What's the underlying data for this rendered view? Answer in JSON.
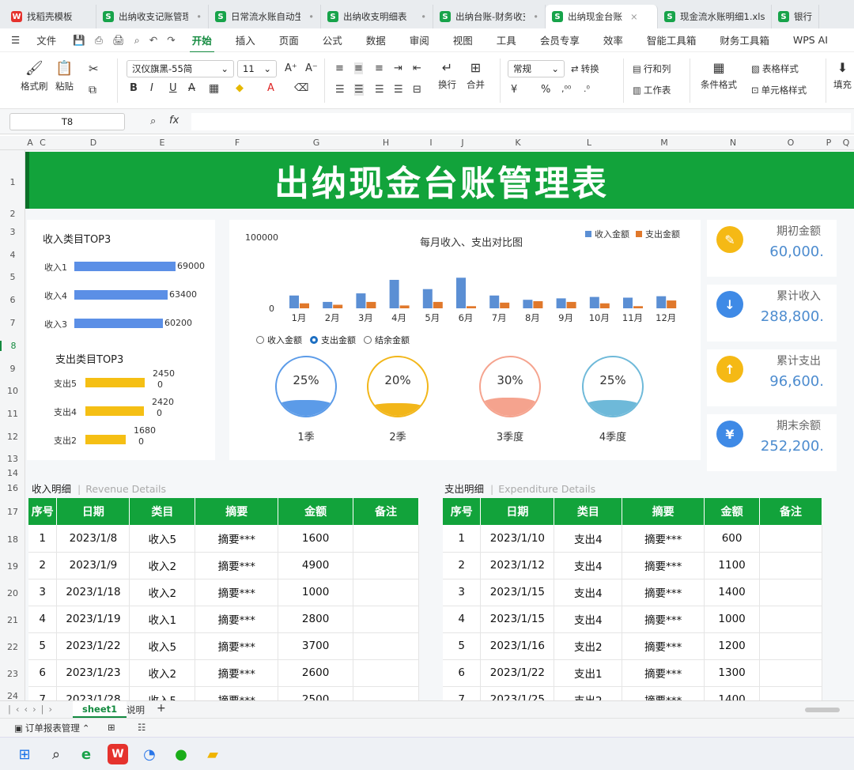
{
  "tabs": [
    {
      "label": "找稻壳模板",
      "icon": "wps-icon"
    },
    {
      "label": "出纳收支记账管理",
      "icon": "sheet-icon"
    },
    {
      "label": "日常流水账自动生",
      "icon": "sheet-icon"
    },
    {
      "label": "出纳收支明细表（",
      "icon": "sheet-icon"
    },
    {
      "label": "出纳台账-财务收支",
      "icon": "sheet-icon"
    },
    {
      "label": "出纳现金台账",
      "icon": "sheet-icon"
    },
    {
      "label": "现金流水账明细1.xlsx",
      "icon": "sheet-icon"
    },
    {
      "label": "银行存",
      "icon": "sheet-icon"
    }
  ],
  "menu": [
    "文件",
    "开始",
    "插入",
    "页面",
    "公式",
    "数据",
    "审阅",
    "视图",
    "工具",
    "会员专享",
    "效率",
    "智能工具箱",
    "财务工具箱",
    "WPS AI"
  ],
  "toolbar": {
    "format_painter": "格式刷",
    "paste": "粘贴",
    "font_name": "汉仪旗黑-55简",
    "font_size": "11",
    "bold": "B",
    "italic": "I",
    "underline": "U",
    "strike": "A",
    "wrap": "换行",
    "merge": "合并",
    "number_format": "常规",
    "convert": "转换",
    "row_col": "行和列",
    "worksheet": "工作表",
    "table_style": "表格样式",
    "cond_format": "条件格式",
    "cell_style": "单元格样式",
    "fill": "填充",
    "yen": "¥",
    "percent": "%"
  },
  "formula": {
    "cell_ref": "T8",
    "fx": "fx",
    "content": ""
  },
  "columns": [
    "A",
    "C",
    "D",
    "E",
    "F",
    "G",
    "H",
    "I",
    "J",
    "K",
    "L",
    "M",
    "N",
    "O",
    "P",
    "Q"
  ],
  "rows": [
    "1",
    "2",
    "3",
    "4",
    "5",
    "6",
    "7",
    "8",
    "9",
    "10",
    "11",
    "12",
    "13",
    "14",
    "15",
    "16",
    "17",
    "18",
    "19",
    "20",
    "21",
    "22",
    "23",
    "24"
  ],
  "banner_title": "出纳现金台账管理表",
  "income_top": {
    "title": "收入类目TOP3",
    "items": [
      {
        "label": "收入1",
        "value": "69000",
        "v": 69000
      },
      {
        "label": "收入4",
        "value": "63400",
        "v": 63400
      },
      {
        "label": "收入3",
        "value": "60200",
        "v": 60200
      }
    ]
  },
  "expense_top": {
    "title": "支出类目TOP3",
    "items": [
      {
        "label": "支出5",
        "value": "2450",
        "zero": "0",
        "v": 2450
      },
      {
        "label": "支出4",
        "value": "2420",
        "zero": "0",
        "v": 2420
      },
      {
        "label": "支出2",
        "value": "1680",
        "zero": "0",
        "v": 1680
      }
    ]
  },
  "chart_data": {
    "type": "bar",
    "title": "每月收入、支出对比图",
    "categories": [
      "1月",
      "2月",
      "3月",
      "4月",
      "5月",
      "6月",
      "7月",
      "8月",
      "9月",
      "10月",
      "11月",
      "12月"
    ],
    "series": [
      {
        "name": "收入金额",
        "color": "#5b8fd4",
        "values": [
          18000,
          9000,
          21000,
          40000,
          27000,
          43000,
          18000,
          12000,
          14000,
          16000,
          15000,
          17000
        ]
      },
      {
        "name": "支出金额",
        "color": "#e0782b",
        "values": [
          7000,
          5000,
          9000,
          4000,
          9000,
          3000,
          8000,
          10000,
          9000,
          7000,
          3000,
          11000
        ]
      }
    ],
    "ylim": [
      0,
      100000
    ],
    "ytick_top": "100000",
    "ytick_bottom": "0",
    "legend": "top-right"
  },
  "radios": [
    {
      "label": "收入金额",
      "selected": false
    },
    {
      "label": "支出金额",
      "selected": true
    },
    {
      "label": "结余金额",
      "selected": false
    }
  ],
  "quarters": [
    {
      "pct": "25%",
      "fraction": 0.25,
      "label": "1季",
      "color": "#5b9be8",
      "border": "#5b9be8"
    },
    {
      "pct": "20%",
      "fraction": 0.2,
      "label": "2季",
      "color": "#f2b619",
      "border": "#f2b619"
    },
    {
      "pct": "30%",
      "fraction": 0.3,
      "label": "3季度",
      "color": "#f5a38e",
      "border": "#f5a38e"
    },
    {
      "pct": "25%",
      "fraction": 0.25,
      "label": "4季度",
      "color": "#6eb9d9",
      "border": "#6eb9d9"
    }
  ],
  "kpis": [
    {
      "title": "期初金额",
      "value": "60,000.",
      "icon": "edit-icon",
      "color": "#f5b915",
      "glyph": "✎"
    },
    {
      "title": "累计收入",
      "value": "288,800.",
      "icon": "arrow-down-icon",
      "color": "#3f8ae6",
      "glyph": "↓"
    },
    {
      "title": "累计支出",
      "value": "96,600.",
      "icon": "arrow-up-icon",
      "color": "#f5b915",
      "glyph": "↑"
    },
    {
      "title": "期末余额",
      "value": "252,200.",
      "icon": "yen-icon",
      "color": "#3f8ae6",
      "glyph": "¥"
    }
  ],
  "income_detail": {
    "title": "收入明细",
    "title_en": "Revenue Details",
    "headers": [
      "序号",
      "日期",
      "类目",
      "摘要",
      "金额",
      "备注"
    ],
    "rows": [
      [
        "1",
        "2023/1/8",
        "收入5",
        "摘要***",
        "1600",
        ""
      ],
      [
        "2",
        "2023/1/9",
        "收入2",
        "摘要***",
        "4900",
        ""
      ],
      [
        "3",
        "2023/1/18",
        "收入2",
        "摘要***",
        "1000",
        ""
      ],
      [
        "4",
        "2023/1/19",
        "收入1",
        "摘要***",
        "2800",
        ""
      ],
      [
        "5",
        "2023/1/22",
        "收入5",
        "摘要***",
        "3700",
        ""
      ],
      [
        "6",
        "2023/1/23",
        "收入2",
        "摘要***",
        "2600",
        ""
      ],
      [
        "7",
        "2023/1/28",
        "收入5",
        "摘要***",
        "2500",
        ""
      ]
    ]
  },
  "expense_detail": {
    "title": "支出明细",
    "title_en": "Expenditure Details",
    "headers": [
      "序号",
      "日期",
      "类目",
      "摘要",
      "金额",
      "备注"
    ],
    "rows": [
      [
        "1",
        "2023/1/10",
        "支出4",
        "摘要***",
        "600",
        ""
      ],
      [
        "2",
        "2023/1/12",
        "支出4",
        "摘要***",
        "1100",
        ""
      ],
      [
        "3",
        "2023/1/15",
        "支出4",
        "摘要***",
        "1400",
        ""
      ],
      [
        "4",
        "2023/1/15",
        "支出4",
        "摘要***",
        "1000",
        ""
      ],
      [
        "5",
        "2023/1/16",
        "支出2",
        "摘要***",
        "1200",
        ""
      ],
      [
        "6",
        "2023/1/22",
        "支出1",
        "摘要***",
        "1300",
        ""
      ],
      [
        "7",
        "2023/1/25",
        "支出2",
        "摘要***",
        "1400",
        ""
      ]
    ]
  },
  "sheet_tabs": [
    "sheet1",
    "说明"
  ],
  "status": {
    "label": "订单报表管理"
  }
}
